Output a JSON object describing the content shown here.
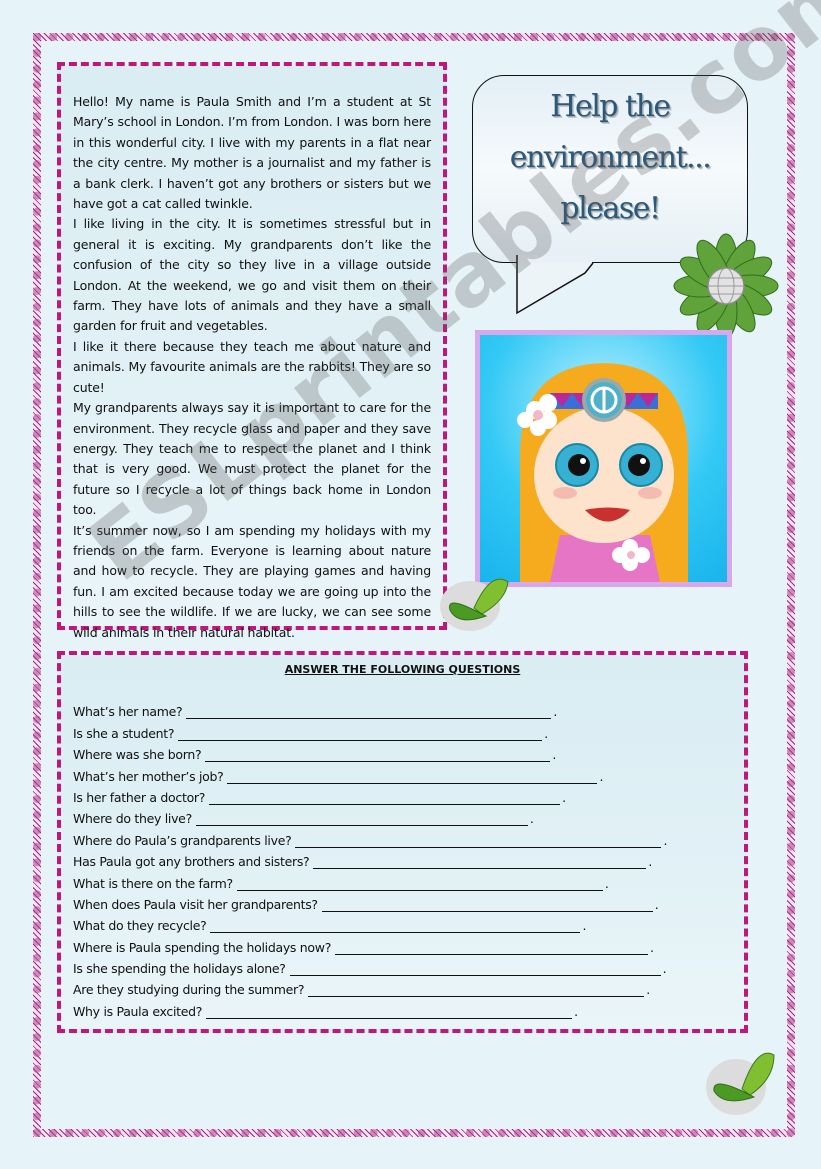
{
  "passage": {
    "paragraphs": [
      "Hello! My name is Paula Smith and I’m a student at St Mary’s school in London. I’m from London. I was born here in this wonderful city. I live with my parents in a flat near the city centre. My mother is a journalist and my father is a bank clerk. I haven’t got any brothers or sisters but we have got a cat called twinkle.",
      "I like living in the city. It is sometimes stressful but in general it is exciting. My grandparents don’t like the confusion of the city so they live in a village outside London. At the weekend, we go and visit them on their farm.  They have lots of animals and they have a small garden for fruit and vegetables.",
      "I like it there because they teach me about nature and animals. My favourite animals are the rabbits! They are so cute!",
      "My grandparents always say it is important to care for the environment. They recycle glass and paper and they save energy. They teach me to respect the planet and I think that is very good.  We must protect the planet for the future so I recycle a lot of things back home in London too.",
      "It’s summer now, so I am spending my holidays with my friends on the farm. Everyone is learning about nature and how to recycle. They are playing games and having fun. I am excited because today we are going up into the hills to see the wildlife. If we are lucky, we can see some wild animals in their natural habitat."
    ]
  },
  "bubble": {
    "lines": [
      "Help the",
      "environment...",
      "please!"
    ]
  },
  "questions": {
    "title": "ANSWER THE FOLLOWING QUESTIONS",
    "items": [
      {
        "text": "What’s her name?"
      },
      {
        "text": "Is she a student?"
      },
      {
        "text": "Where was she born?"
      },
      {
        "text": "What’s her mother’s job?"
      },
      {
        "text": "Is her father a doctor?"
      },
      {
        "text": "Where do they live?"
      },
      {
        "text": "Where do Paula’s grandparents live?"
      },
      {
        "text": "Has Paula got any brothers and sisters?"
      },
      {
        "text": "What is there on the farm?"
      },
      {
        "text": "When does Paula visit her grandparents?"
      },
      {
        "text": "What do they recycle?"
      },
      {
        "text": "Where is Paula spending the holidays now?"
      },
      {
        "text": "Is she spending the holidays alone?"
      },
      {
        "text": "Are they studying during the summer?"
      },
      {
        "text": "Why is Paula excited?"
      }
    ],
    "end_mark": "."
  },
  "watermark": "ESLprintables.com",
  "icons": {
    "flower": "flower-globe-icon",
    "butterfly": "butterfly-icon",
    "portrait": "girl-portrait-illustration"
  },
  "colors": {
    "border_accent": "#c0187a",
    "title_text": "#2f5877",
    "background": "#e6f3f8"
  }
}
